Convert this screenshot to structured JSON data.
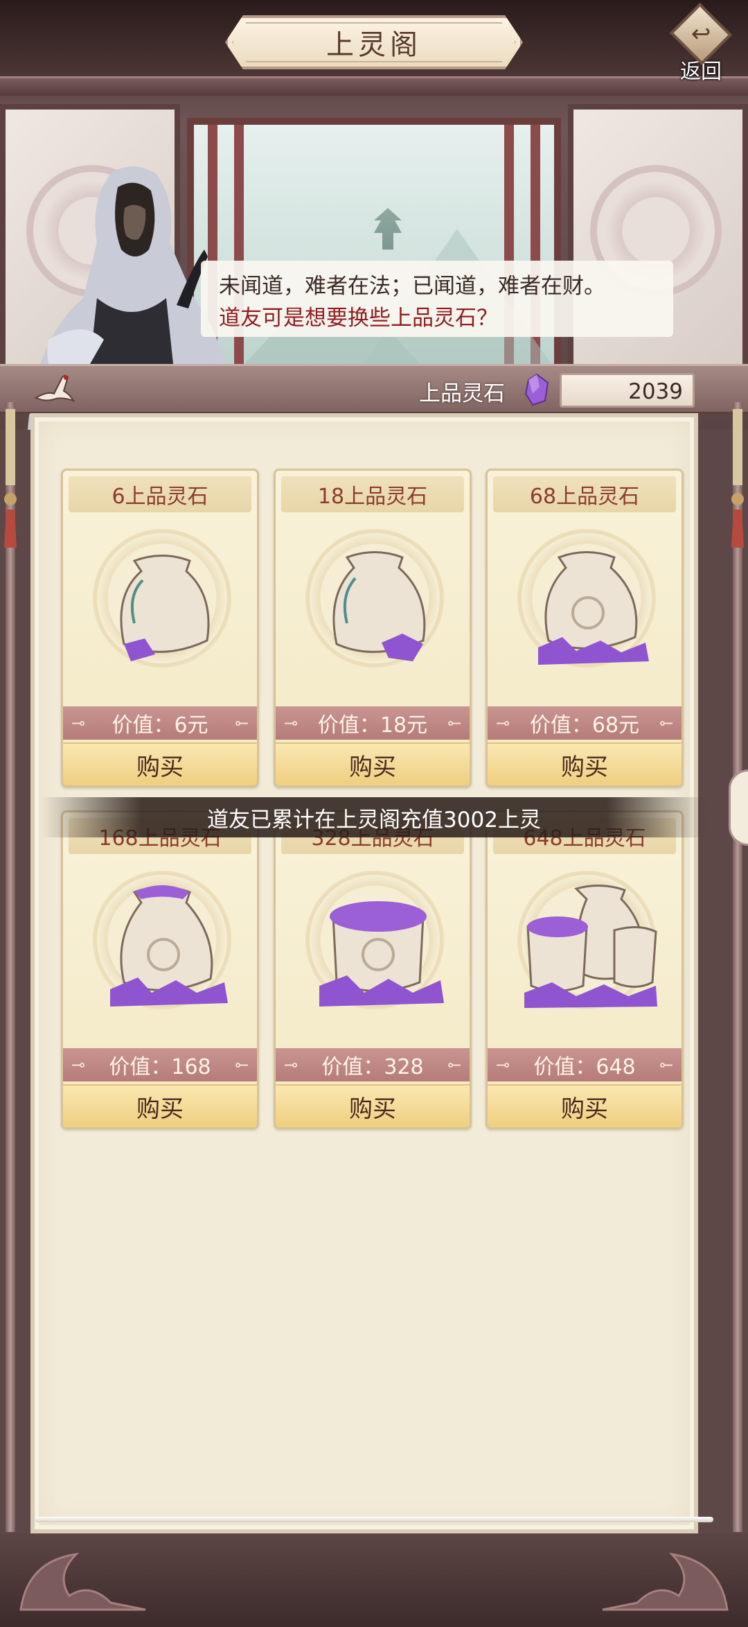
{
  "header": {
    "title": "上灵阁",
    "back_label": "返回"
  },
  "dialog": {
    "line1": "未闻道，难者在法；已闻道，难者在财。",
    "line2": "道友可是想要换些上品灵石？"
  },
  "currency": {
    "label": "上品灵石",
    "value": "2039",
    "icon": "purple-spirit-stone-icon",
    "color": "#9b5fd6"
  },
  "products": [
    {
      "title": "6上品灵石",
      "price": "价值：6元",
      "buy": "购买",
      "art": "small-bag"
    },
    {
      "title": "18上品灵石",
      "price": "价值：18元",
      "buy": "购买",
      "art": "bag-few-stones"
    },
    {
      "title": "68上品灵石",
      "price": "价值：68元",
      "buy": "购买",
      "art": "bag-many-stones"
    },
    {
      "title": "168上品灵石",
      "price": "价值：168",
      "buy": "购买",
      "art": "bag-shiny"
    },
    {
      "title": "328上品灵石",
      "price": "价值：328",
      "buy": "购买",
      "art": "open-bag-full"
    },
    {
      "title": "648上品灵石",
      "price": "价值：648",
      "buy": "购买",
      "art": "three-bags"
    }
  ],
  "toast": {
    "text": "道友已累计在上灵阁充值3002上灵"
  },
  "colors": {
    "accent_red": "#8f1f1f",
    "card_bg": "#f6eed0",
    "price_band": "#bf8884",
    "buy_button": "#f3d88f",
    "frame": "#5e4747"
  }
}
